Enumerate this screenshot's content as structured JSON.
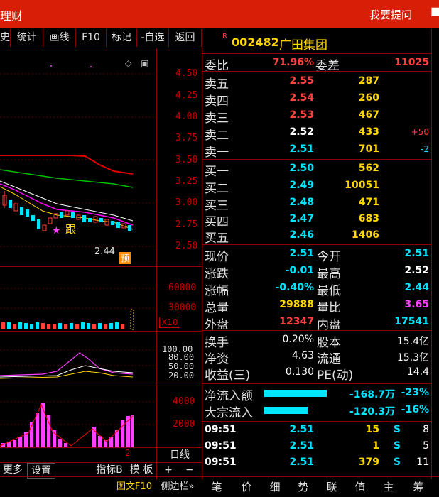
{
  "title_bar": {
    "left_text": "理财",
    "help_label": "我要提问"
  },
  "toolbar": {
    "items": [
      "史",
      "统计",
      "画线",
      "F10",
      "标记",
      "-自选",
      "返回"
    ]
  },
  "price_axis": {
    "labels": [
      "4.50",
      "4.25",
      "4.00",
      "3.75",
      "3.50",
      "3.25",
      "3.00",
      "2.75",
      "2.50"
    ]
  },
  "chart_annotations": {
    "low_price": "2.44",
    "forecast_badge": "预",
    "follow_label": "跟"
  },
  "volume_panel": {
    "labels": [
      "60000",
      "30000"
    ],
    "unit": "X10"
  },
  "indicator_panel": {
    "labels": [
      "100.00",
      "80.00",
      "50.00",
      "20.00"
    ]
  },
  "flow_panel": {
    "labels": [
      "4000",
      "2000"
    ]
  },
  "chart_bottom": {
    "tick": "2",
    "period": "日线",
    "more": "更多",
    "settings": "设置",
    "indicator": "指标B",
    "template": "模 板",
    "plus": "+",
    "minus": "−"
  },
  "stock": {
    "badge": "R",
    "code": "002482",
    "name": "广田集团"
  },
  "ratio": {
    "label1": "委比",
    "value1": "71.96%",
    "label2": "委差",
    "value2": "11025"
  },
  "sell": [
    {
      "label": "卖五",
      "price": "2.55",
      "vol": "287",
      "chg": ""
    },
    {
      "label": "卖四",
      "price": "2.54",
      "vol": "260",
      "chg": ""
    },
    {
      "label": "卖三",
      "price": "2.53",
      "vol": "467",
      "chg": ""
    },
    {
      "label": "卖二",
      "price": "2.52",
      "vol": "433",
      "chg": "+50"
    },
    {
      "label": "卖一",
      "price": "2.51",
      "vol": "701",
      "chg": "-2"
    }
  ],
  "buy": [
    {
      "label": "买一",
      "price": "2.50",
      "vol": "562"
    },
    {
      "label": "买二",
      "price": "2.49",
      "vol": "10051"
    },
    {
      "label": "买三",
      "price": "2.48",
      "vol": "471"
    },
    {
      "label": "买四",
      "price": "2.47",
      "vol": "683"
    },
    {
      "label": "买五",
      "price": "2.46",
      "vol": "1406"
    }
  ],
  "quote": [
    {
      "l1": "现价",
      "v1": "2.51",
      "l2": "今开",
      "v2": "2.51"
    },
    {
      "l1": "涨跌",
      "v1": "-0.01",
      "l2": "最高",
      "v2": "2.52"
    },
    {
      "l1": "涨幅",
      "v1": "-0.40%",
      "l2": "最低",
      "v2": "2.44"
    },
    {
      "l1": "总量",
      "v1": "29888",
      "l2": "量比",
      "v2": "3.65"
    },
    {
      "l1": "外盘",
      "v1": "12347",
      "l2": "内盘",
      "v2": "17541"
    }
  ],
  "fundamentals": [
    {
      "l1": "换手",
      "v1": "0.20%",
      "l2": "股本",
      "v2": "15.4亿"
    },
    {
      "l1": "净资",
      "v1": "4.63",
      "l2": "流通",
      "v2": "15.3亿"
    },
    {
      "l1": "收益(三)",
      "v1": "0.130",
      "l2": "PE(动)",
      "v2": "14.4"
    }
  ],
  "flows": [
    {
      "label": "净流入额",
      "value": "-168.7万",
      "pct": "-23%",
      "bar_fraction": 0.95
    },
    {
      "label": "大宗流入",
      "value": "-120.3万",
      "pct": "-16%",
      "bar_fraction": 0.72
    }
  ],
  "ticks": [
    {
      "time": "09:51",
      "price": "2.51",
      "vol": "15",
      "side": "S",
      "n": "8"
    },
    {
      "time": "09:51",
      "price": "2.51",
      "vol": "1",
      "side": "S",
      "n": "5"
    },
    {
      "time": "09:51",
      "price": "2.51",
      "vol": "379",
      "side": "S",
      "n": "11"
    }
  ],
  "bottom_tabs": {
    "f10": "图文F10",
    "sidebar": "侧边栏»",
    "tabs": [
      "笔",
      "价",
      "细",
      "势",
      "联",
      "值",
      "主",
      "筹"
    ]
  },
  "colors": {
    "title_bg": "#d81e06",
    "grid": "#8b0000",
    "up": "#ff4040",
    "down": "#00e5ff"
  }
}
